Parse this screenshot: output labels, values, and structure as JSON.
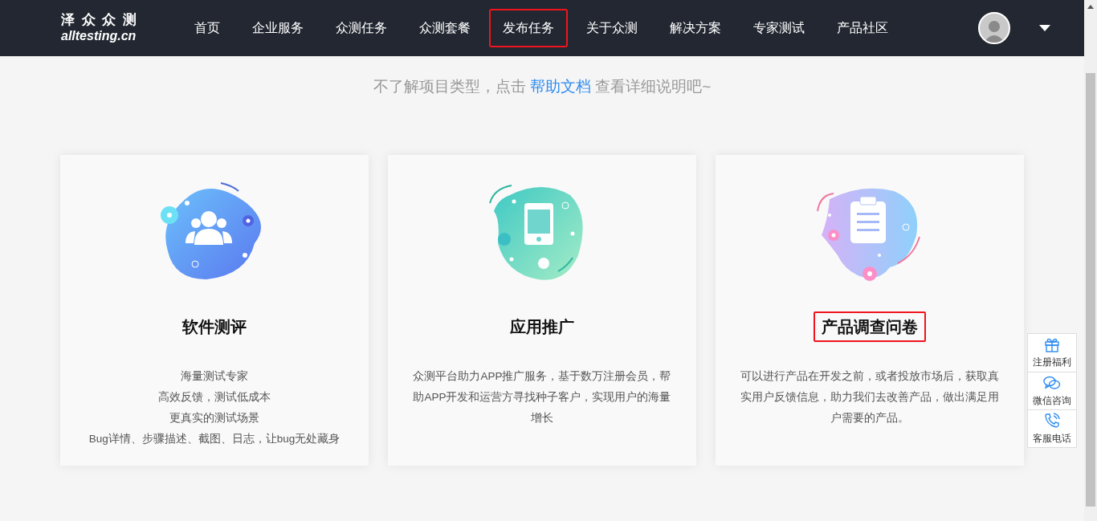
{
  "header": {
    "logo": {
      "name": "泽 众 众 测",
      "domain": "alltesting.cn"
    },
    "nav": [
      {
        "label": "首页",
        "highlighted": false
      },
      {
        "label": "企业服务",
        "highlighted": false
      },
      {
        "label": "众测任务",
        "highlighted": false
      },
      {
        "label": "众测套餐",
        "highlighted": false
      },
      {
        "label": "发布任务",
        "highlighted": true
      },
      {
        "label": "关于众测",
        "highlighted": false
      },
      {
        "label": "解决方案",
        "highlighted": false
      },
      {
        "label": "专家测试",
        "highlighted": false
      },
      {
        "label": "产品社区",
        "highlighted": false
      }
    ]
  },
  "hint": {
    "before": "不了解项目类型，点击 ",
    "link": "帮助文档",
    "after": " 查看详细说明吧~"
  },
  "cards": [
    {
      "kind": "people",
      "title": "软件测评",
      "highlighted": false,
      "lines": [
        "海量测试专家",
        "高效反馈，测试低成本",
        "更真实的测试场景",
        "Bug详情、步骤描述、截图、日志，让bug无处藏身"
      ]
    },
    {
      "kind": "phone",
      "title": "应用推广",
      "highlighted": false,
      "lines": [
        "众测平台助力APP推广服务，基于数万注册会员，帮助APP开发和运营方寻找种子客户，实现用户的海量增长"
      ]
    },
    {
      "kind": "clipboard",
      "title": "产品调查问卷",
      "highlighted": true,
      "lines": [
        "可以进行产品在开发之前，或者投放市场后，获取真实用户反馈信息，助力我们去改善产品，做出满足用户需要的产品。"
      ]
    }
  ],
  "side_panel": [
    {
      "kind": "gift",
      "label": "注册福利"
    },
    {
      "kind": "chat",
      "label": "微信咨询"
    },
    {
      "kind": "phone",
      "label": "客服电话"
    }
  ]
}
